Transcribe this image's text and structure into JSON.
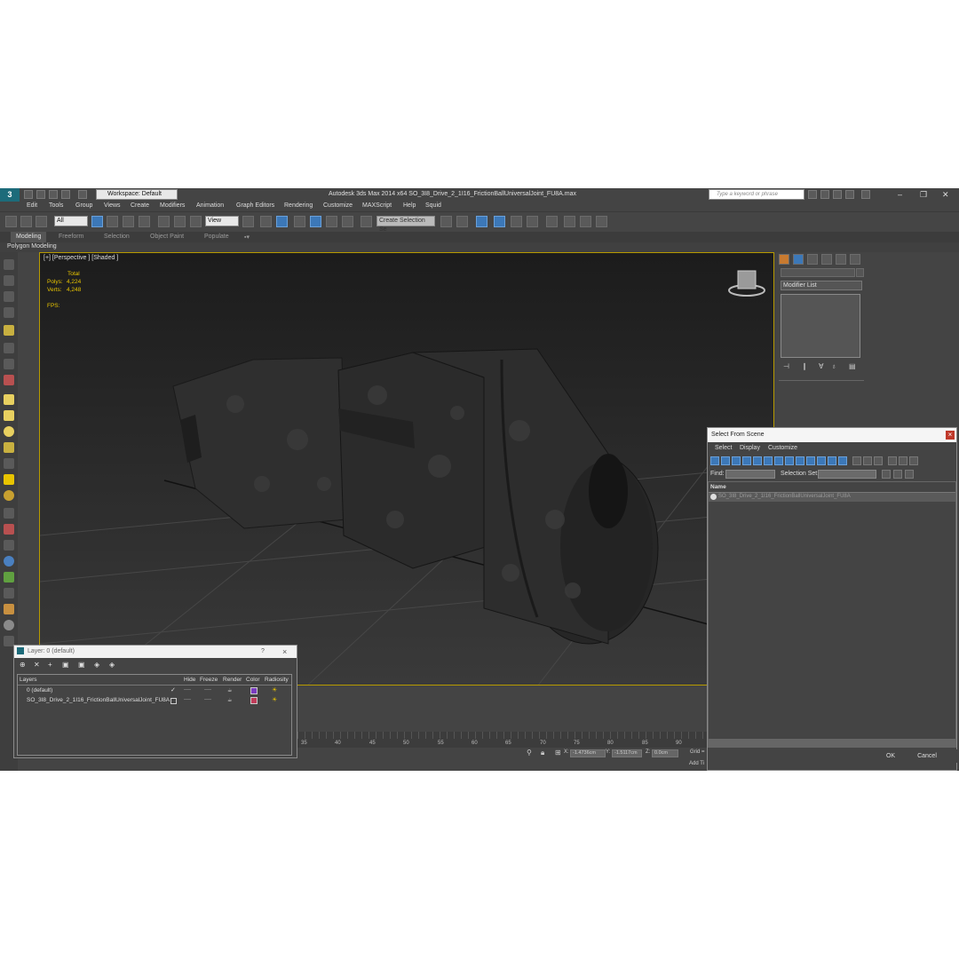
{
  "app": {
    "title": "Autodesk 3ds Max  2014 x64    SO_3I8_Drive_2_1I16_FrictionBallUniversalJoint_FU8A.max",
    "workspace": "Workspace: Default",
    "search_placeholder": "Type a keyword or phrase",
    "logo": "3"
  },
  "menu": [
    "Edit",
    "Tools",
    "Group",
    "Views",
    "Create",
    "Modifiers",
    "Animation",
    "Graph Editors",
    "Rendering",
    "Customize",
    "MAXScript",
    "Help",
    "Squid"
  ],
  "toolbar": {
    "filter": "All",
    "reference": "View",
    "selection_set": "Create Selection Se"
  },
  "ribbon": {
    "tabs": [
      "Modeling",
      "Freeform",
      "Selection",
      "Object Paint",
      "Populate"
    ],
    "active": "Modeling",
    "sub": "Polygon Modeling"
  },
  "viewport": {
    "label": "[+] [Perspective ] [Shaded ]",
    "stats": {
      "total": "Total",
      "polys_label": "Polys:",
      "polys": "4,224",
      "verts_label": "Verts:",
      "verts": "4,248",
      "fps": "FPS:"
    }
  },
  "command_panel": {
    "modifier_list": "Modifier List"
  },
  "timeline": {
    "ticks": [
      "35",
      "40",
      "45",
      "50",
      "55",
      "60",
      "65",
      "70",
      "75",
      "80",
      "85",
      "90"
    ]
  },
  "status": {
    "x_label": "X:",
    "x": "-1.4736cm",
    "y_label": "Y:",
    "y": "-1.5117cm",
    "z_label": "Z:",
    "z": "0.0cm",
    "grid": "Grid =",
    "add_time": "Add Ti"
  },
  "layer_dialog": {
    "title": "Layer: 0 (default)",
    "help": "?",
    "close": "×",
    "columns": [
      "Layers",
      "Hide",
      "Freeze",
      "Render",
      "Color",
      "Radiosity"
    ],
    "rows": [
      {
        "name": "0 (default)",
        "hide": "----",
        "freeze": "----"
      },
      {
        "name": "SO_3I8_Drive_2_1I16_FrictionBallUniversalJoint_FU8A",
        "hide": "----",
        "freeze": "----"
      }
    ]
  },
  "select_dialog": {
    "title": "Select From Scene",
    "close": "×",
    "menu": [
      "Select",
      "Display",
      "Customize"
    ],
    "find_label": "Find:",
    "selset_label": "Selection Set:",
    "column": "Name",
    "item": "SO_3I8_Drive_2_1I16_FrictionBallUniversalJoint_FU8A",
    "ok": "OK",
    "cancel": "Cancel"
  },
  "colors": {
    "viewport_border": "#b79a00",
    "stats": "#e8c400",
    "accent": "#3c78b8"
  }
}
